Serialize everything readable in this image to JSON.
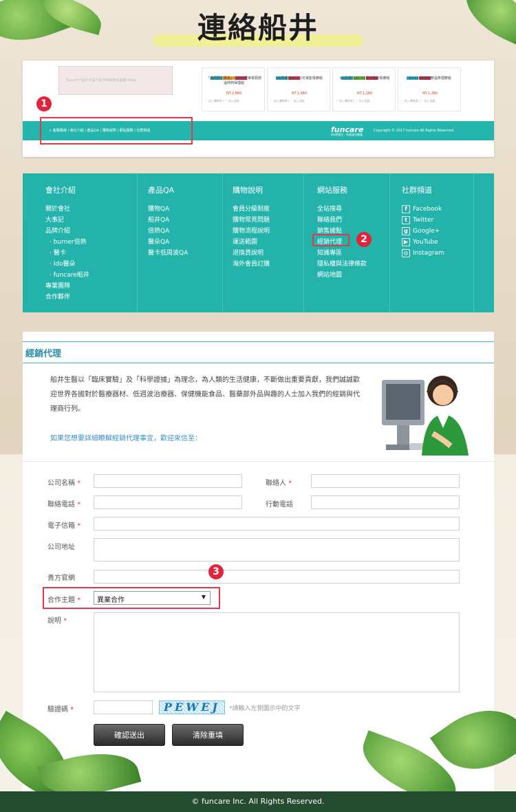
{
  "page": {
    "title": "連絡船井",
    "footer": "© funcare Inc. All Rights Reserved."
  },
  "annotations": [
    "1",
    "2",
    "3"
  ],
  "card1": {
    "search_placeholder": "Search™船井®深力溝卡瞬美棒加溫機 60kg",
    "products": [
      {
        "name": "「高周配送專案」船井全型導電頸部溫熱熱保理組",
        "price": "NT.2,880",
        "actions": "♡ 加入購物車 | ♡ 加入追蹤"
      },
      {
        "name": "Ido負電位AC-11光電能電療組",
        "price": "NT.1,980",
        "actions": "♡ 加入購物車 | ♡ 加入追蹤"
      },
      {
        "name": "Ido負電位AC-11電光電能電療組",
        "price": "NT.1,180",
        "actions": "♡ 加入購物車 | ♡ 加入追蹤"
      },
      {
        "name": "burner健康熱敷溫熱理療組",
        "price": "NT.1,280",
        "actions": "♡ 加入購物車 | ♡ 加入追蹤"
      }
    ],
    "footer_links": "+ 客服專線 | 會社介紹 | 產品QA | 購物說明 | 網站服務 | 社群頻道",
    "logo": "funcare",
    "logo_sub": "Ido負電位 · 低周波治療器",
    "copyright": "Copyright © 2017 funcare All Rights Reserved."
  },
  "card2": {
    "columns": [
      {
        "title": "會社介紹",
        "items": [
          "關於會社",
          "大事記",
          "品牌介紹",
          "· burner倍熱",
          "· 醫卡",
          "· Ido醫朵",
          "· funcare船井",
          "專業團隊",
          "合作夥伴"
        ]
      },
      {
        "title": "產品QA",
        "items": [
          "購物QA",
          "船井QA",
          "倍熱QA",
          "醫朵QA",
          "醫卡低周波QA"
        ]
      },
      {
        "title": "購物說明",
        "items": [
          "會員分級制度",
          "購物常見問題",
          "購物流程說明",
          "運送範圍",
          "退換貨說明",
          "海外會員訂購"
        ]
      },
      {
        "title": "網站服務",
        "items": [
          "全站搜尋",
          "聯絡我們",
          "銷售據點",
          "經銷代理",
          "知識專區",
          "隱私權與法律條款",
          "網站地圖"
        ]
      },
      {
        "title": "社群頻道",
        "items": [
          "Facebook",
          "Twitter",
          "Google+",
          "YouTube",
          "Instagram"
        ]
      }
    ]
  },
  "card3": {
    "heading": "經銷代理",
    "intro": "船井生醫以「臨床實驗」及「科學證據」為理念，為人類的生活健康，不斷做出重要貢獻，我們誠誠歡迎世界各國對於醫療器材、低週波治療器、保健機能食品、醫藥部外品與趣的人士加入我們的經銷與代理商行列。",
    "intro_link": "如果您想要詳細瞭解經銷代理事宜，歡迎來信至：",
    "form": {
      "company": "公司名稱",
      "contact": "聯絡人",
      "phone": "聯絡電話",
      "mobile": "行動電話",
      "email": "電子信箱",
      "address": "公司地址",
      "website": "貴方官網",
      "topic": "合作主題",
      "topic_value": "異業合作",
      "desc": "說明",
      "captcha": "驗證碼",
      "captcha_text": "PEWEJ",
      "captcha_hint": "*請輸入左側圖示中的文字",
      "submit": "確認送出",
      "reset": "清除重填",
      "required": "*"
    }
  }
}
